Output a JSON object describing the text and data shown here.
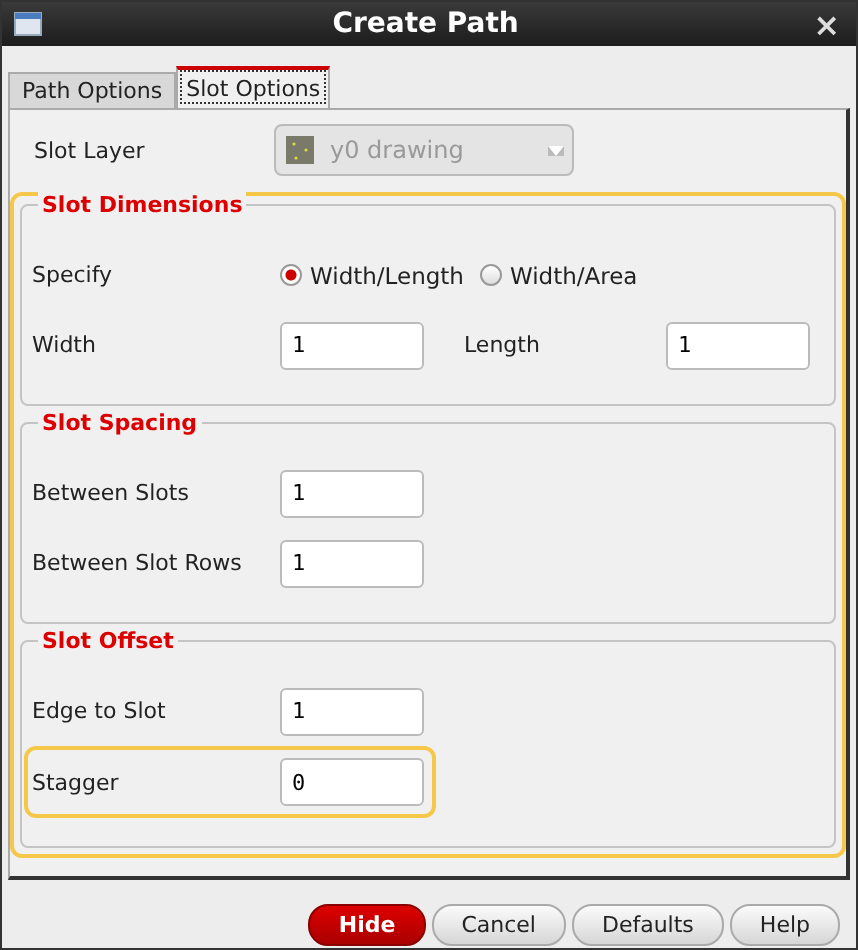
{
  "window": {
    "title": "Create Path",
    "close": "×"
  },
  "tabs": [
    {
      "label": "Path Options",
      "selected": false
    },
    {
      "label": "Slot Options",
      "selected": true
    }
  ],
  "slot_layer": {
    "label": "Slot Layer",
    "value": "y0 drawing",
    "disabled": true
  },
  "groups_highlighted": true,
  "groups": [
    {
      "title": "Slot Dimensions",
      "rows": [
        {
          "kind": "radio",
          "label": "Specify",
          "options": [
            {
              "label": "Width/Length",
              "selected": true
            },
            {
              "label": "Width/Area",
              "selected": false
            }
          ]
        },
        {
          "kind": "pair",
          "label": "Width",
          "value": "1",
          "label2": "Length",
          "value2": "1"
        }
      ]
    },
    {
      "title": "Slot Spacing",
      "rows": [
        {
          "kind": "field",
          "label": "Between Slots",
          "value": "1",
          "highlighted": false
        },
        {
          "kind": "field",
          "label": "Between Slot Rows",
          "value": "1",
          "highlighted": false
        }
      ]
    },
    {
      "title": "Slot Offset",
      "rows": [
        {
          "kind": "field",
          "label": "Edge to Slot",
          "value": "1",
          "highlighted": false
        },
        {
          "kind": "field",
          "label": "Stagger",
          "value": "0",
          "highlighted": true
        }
      ]
    }
  ],
  "buttons": [
    {
      "label": "Hide",
      "primary": true
    },
    {
      "label": "Cancel",
      "primary": false
    },
    {
      "label": "Defaults",
      "primary": false
    },
    {
      "label": "Help",
      "primary": false
    }
  ]
}
